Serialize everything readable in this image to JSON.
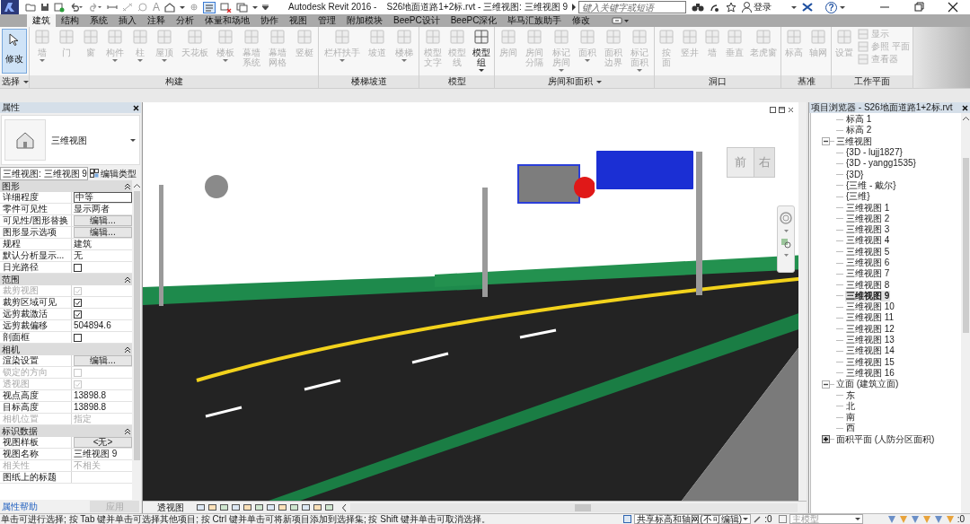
{
  "title_bar": {
    "text_glyph": "A",
    "title": "Autodesk Revit 2016 -    S26地面道路1+2标.rvt - 三维视图: 三维视图 9",
    "search_placeholder": "键入关键字或短语",
    "sign_in": "登录",
    "help": "?"
  },
  "tabs": [
    {
      "label": "建筑",
      "selected": true
    },
    {
      "label": "结构",
      "selected": false
    },
    {
      "label": "系统",
      "selected": false
    },
    {
      "label": "插入",
      "selected": false
    },
    {
      "label": "注释",
      "selected": false
    },
    {
      "label": "分析",
      "selected": false
    },
    {
      "label": "体量和场地",
      "selected": false
    },
    {
      "label": "协作",
      "selected": false
    },
    {
      "label": "视图",
      "selected": false
    },
    {
      "label": "管理",
      "selected": false
    },
    {
      "label": "附加模块",
      "selected": false
    },
    {
      "label": "BeePC设计",
      "selected": false
    },
    {
      "label": "BeePC深化",
      "selected": false
    },
    {
      "label": "毕马汇族助手",
      "selected": false
    },
    {
      "label": "修改",
      "selected": false
    }
  ],
  "ribbon": {
    "panels": [
      {
        "title": "选择",
        "dropdown": true,
        "tools": [
          {
            "label": "修改",
            "kind": "modify",
            "active": true,
            "disabled": false
          }
        ]
      },
      {
        "title": "构建",
        "dropdown": false,
        "tools": [
          {
            "label": "墙",
            "kind": "large",
            "disabled": true,
            "dropdown": true
          },
          {
            "label": "门",
            "kind": "large",
            "disabled": true,
            "dropdown": false
          },
          {
            "label": "窗",
            "kind": "large",
            "disabled": true,
            "dropdown": false
          },
          {
            "label": "构件",
            "kind": "large",
            "disabled": true,
            "dropdown": true
          },
          {
            "label": "柱",
            "kind": "large",
            "disabled": true,
            "dropdown": true
          },
          {
            "label": "屋顶",
            "kind": "large",
            "disabled": true,
            "dropdown": true
          },
          {
            "label": "天花板",
            "kind": "large",
            "disabled": true,
            "dropdown": false
          },
          {
            "label": "楼板",
            "kind": "large",
            "disabled": true,
            "dropdown": true
          },
          {
            "label": "幕墙系统",
            "kind": "large",
            "wrap": true,
            "disabled": true,
            "dropdown": false
          },
          {
            "label": "幕墙网格",
            "kind": "large",
            "wrap": true,
            "disabled": true,
            "dropdown": false
          },
          {
            "label": "竖梃",
            "kind": "large",
            "disabled": true,
            "dropdown": false
          }
        ]
      },
      {
        "title": "楼梯坡道",
        "dropdown": false,
        "tools": [
          {
            "label": "栏杆扶手",
            "kind": "large",
            "disabled": true,
            "dropdown": true
          },
          {
            "label": "坡道",
            "kind": "large",
            "disabled": true,
            "dropdown": false
          },
          {
            "label": "楼梯",
            "kind": "large",
            "disabled": true,
            "dropdown": true
          }
        ]
      },
      {
        "title": "模型",
        "dropdown": false,
        "tools": [
          {
            "label": "模型文字",
            "kind": "large",
            "wrap": true,
            "disabled": true,
            "dropdown": false
          },
          {
            "label": "模型线",
            "kind": "large",
            "wrap": true,
            "disabled": true,
            "dropdown": false
          },
          {
            "label": "模型组",
            "kind": "large",
            "wrap": true,
            "disabled": false,
            "dropdown": true
          }
        ]
      },
      {
        "title": "房间和面积",
        "dropdown": true,
        "tools": [
          {
            "label": "房间",
            "kind": "large",
            "disabled": true,
            "dropdown": false
          },
          {
            "label": "房间分隔",
            "kind": "large",
            "wrap": true,
            "disabled": true,
            "dropdown": false
          },
          {
            "label": "标记房间",
            "kind": "large",
            "wrap": true,
            "disabled": true,
            "dropdown": true
          },
          {
            "label": "面积",
            "kind": "large",
            "disabled": true,
            "dropdown": true
          },
          {
            "label": "面积边界",
            "kind": "large",
            "wrap": true,
            "disabled": true,
            "dropdown": false
          },
          {
            "label": "标记面积",
            "kind": "large",
            "wrap": true,
            "disabled": true,
            "dropdown": true
          }
        ]
      },
      {
        "title": "洞口",
        "dropdown": false,
        "tools": [
          {
            "label": "按面",
            "kind": "large",
            "wrap": true,
            "disabled": true,
            "dropdown": false
          },
          {
            "label": "竖井",
            "kind": "large",
            "disabled": true,
            "dropdown": false
          },
          {
            "label": "墙",
            "kind": "large",
            "disabled": true,
            "dropdown": false
          },
          {
            "label": "垂直",
            "kind": "large",
            "disabled": true,
            "dropdown": false
          },
          {
            "label": "老虎窗",
            "kind": "large",
            "disabled": true,
            "dropdown": false
          }
        ]
      },
      {
        "title": "基准",
        "dropdown": false,
        "tools": [
          {
            "label": "标高",
            "kind": "large",
            "disabled": true,
            "dropdown": false
          },
          {
            "label": "轴网",
            "kind": "large",
            "disabled": true,
            "dropdown": false
          }
        ]
      },
      {
        "title": "工作平面",
        "dropdown": false,
        "tools": [
          {
            "label": "设置",
            "kind": "large",
            "disabled": true,
            "dropdown": false
          },
          {
            "label": "显示",
            "kind": "small",
            "disabled": true,
            "dropdown": false
          },
          {
            "label": "参照 平面",
            "kind": "small",
            "disabled": true,
            "dropdown": false
          },
          {
            "label": "查看器",
            "kind": "small",
            "disabled": true,
            "dropdown": false
          }
        ]
      }
    ]
  },
  "properties": {
    "title": "属性",
    "type_name": "三维视图",
    "selector": "三维视图: 三维视图 9",
    "edit_type": "编辑类型",
    "groups": [
      {
        "title": "图形",
        "rows": [
          {
            "label": "详细程度",
            "kind": "input",
            "value": "中等",
            "disabled": false
          },
          {
            "label": "零件可见性",
            "kind": "text",
            "value": "显示两者",
            "disabled": false
          },
          {
            "label": "可见性/图形替换",
            "kind": "button",
            "value": "编辑...",
            "disabled": false
          },
          {
            "label": "图形显示选项",
            "kind": "button",
            "value": "编辑...",
            "disabled": false
          },
          {
            "label": "规程",
            "kind": "text",
            "value": "建筑",
            "disabled": false
          },
          {
            "label": "默认分析显示...",
            "kind": "text",
            "value": "无",
            "disabled": false
          },
          {
            "label": "日光路径",
            "kind": "checkbox",
            "checked": false,
            "disabled": false
          }
        ]
      },
      {
        "title": "范围",
        "rows": [
          {
            "label": "裁剪视图",
            "kind": "checkbox",
            "checked": true,
            "disabled": true
          },
          {
            "label": "裁剪区域可见",
            "kind": "checkbox",
            "checked": true,
            "disabled": false
          },
          {
            "label": "远剪裁激活",
            "kind": "checkbox",
            "checked": true,
            "disabled": false
          },
          {
            "label": "远剪裁偏移",
            "kind": "text",
            "value": "504894.6",
            "disabled": false
          },
          {
            "label": "剖面框",
            "kind": "checkbox",
            "checked": false,
            "disabled": false
          }
        ]
      },
      {
        "title": "相机",
        "rows": [
          {
            "label": "渲染设置",
            "kind": "button",
            "value": "编辑...",
            "disabled": false
          },
          {
            "label": "锁定的方向",
            "kind": "checkbox",
            "checked": false,
            "disabled": true
          },
          {
            "label": "透视图",
            "kind": "checkbox",
            "checked": true,
            "disabled": true
          },
          {
            "label": "视点高度",
            "kind": "text",
            "value": "13898.8",
            "disabled": false
          },
          {
            "label": "目标高度",
            "kind": "text",
            "value": "13898.8",
            "disabled": false
          },
          {
            "label": "相机位置",
            "kind": "text",
            "value": "指定",
            "disabled": true
          }
        ]
      },
      {
        "title": "标识数据",
        "rows": [
          {
            "label": "视图样板",
            "kind": "button",
            "value": "<无>",
            "disabled": false
          },
          {
            "label": "视图名称",
            "kind": "text",
            "value": "三维视图 9",
            "disabled": false
          },
          {
            "label": "相关性",
            "kind": "text",
            "value": "不相关",
            "disabled": true
          },
          {
            "label": "图纸上的标题",
            "kind": "text",
            "disabled": false
          }
        ]
      }
    ],
    "help_link": "属性帮助",
    "apply": {
      "label": "应用",
      "disabled": true
    }
  },
  "viewport": {
    "view_cube": {
      "front": "前",
      "right": "右"
    },
    "view_bar": {
      "label": "透视图"
    }
  },
  "browser": {
    "title": "项目浏览器 - S26地面道路1+2标.rvt",
    "tree": [
      {
        "kind": "continued",
        "children": [
          {
            "label": "标高 1",
            "selected": false
          },
          {
            "label": "标高 2",
            "selected": false
          }
        ]
      },
      {
        "label": "三维视图",
        "expanded": true,
        "selected": false,
        "children": [
          {
            "label": "{3D - lujj1827}",
            "selected": false
          },
          {
            "label": "{3D - yangg1535}",
            "selected": false
          },
          {
            "label": "{3D}",
            "selected": false
          },
          {
            "label": "{三维 - 戴尔}",
            "selected": false
          },
          {
            "label": "{三维}",
            "selected": false
          },
          {
            "label": "三维视图 1",
            "selected": false
          },
          {
            "label": "三维视图 2",
            "selected": false
          },
          {
            "label": "三维视图 3",
            "selected": false
          },
          {
            "label": "三维视图 4",
            "selected": false
          },
          {
            "label": "三维视图 5",
            "selected": false
          },
          {
            "label": "三维视图 6",
            "selected": false
          },
          {
            "label": "三维视图 7",
            "selected": false
          },
          {
            "label": "三维视图 8",
            "selected": false
          },
          {
            "label": "三维视图 9",
            "selected": true
          },
          {
            "label": "三维视图 10",
            "selected": false
          },
          {
            "label": "三维视图 11",
            "selected": false
          },
          {
            "label": "三维视图 12",
            "selected": false
          },
          {
            "label": "三维视图 13",
            "selected": false
          },
          {
            "label": "三维视图 14",
            "selected": false
          },
          {
            "label": "三维视图 15",
            "selected": false
          },
          {
            "label": "三维视图 16",
            "selected": false
          }
        ]
      },
      {
        "label": "立面 (建筑立面)",
        "expanded": true,
        "selected": false,
        "children": [
          {
            "label": "东",
            "selected": false
          },
          {
            "label": "北",
            "selected": false
          },
          {
            "label": "南",
            "selected": false
          },
          {
            "label": "西",
            "selected": false
          }
        ]
      },
      {
        "label": "面积平面 (人防分区面积)",
        "expanded": false,
        "selected": false
      }
    ]
  },
  "status_bar": {
    "message": "单击可进行选择; 按 Tab 键并单击可选择其他项目; 按 Ctrl 键并单击可将新项目添加到选择集; 按 Shift 键并单击可取消选择。",
    "workset": "共享标高和轴网(不可编辑)",
    "workset_count": ":0",
    "design_option": "主模型",
    "filter_count": ":0"
  }
}
